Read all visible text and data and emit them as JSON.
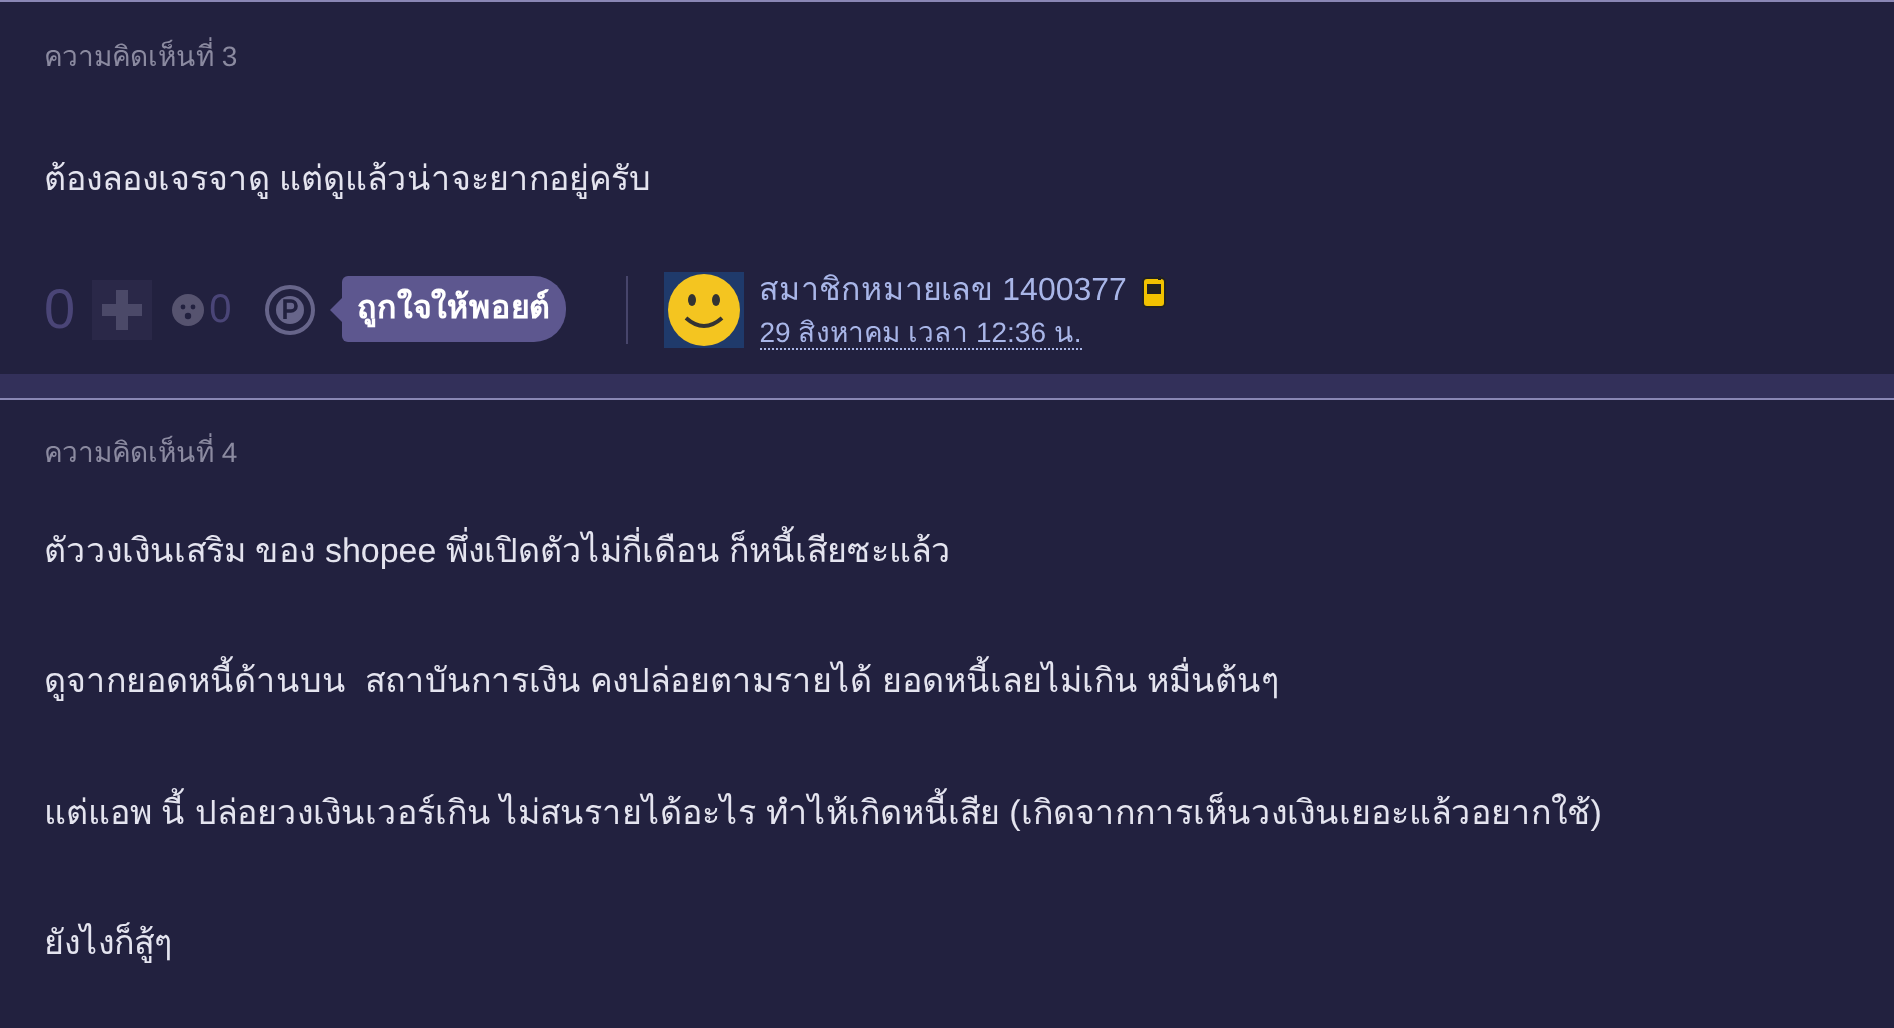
{
  "comments": [
    {
      "label": "ความคิดเห็นที่ 3",
      "paragraphs": [
        "ต้องลองเจรจาดู แต่ดูแล้วน่าจะยากอยู่ครับ"
      ],
      "footer": {
        "score": "0",
        "emotion_count": "0",
        "point_button": "ถูกใจให้พอยต์",
        "member": "สมาชิกหมายเลข 1400377",
        "date": "29 สิงหาคม เวลา 12:36 น."
      }
    },
    {
      "label": "ความคิดเห็นที่ 4",
      "paragraphs": [
        "ตัววงเงินเสริม ของ shopee พึ่งเปิดตัวไม่กี่เดือน ก็หนี้เสียซะแล้ว",
        "ดูจากยอดหนี้ด้านบน  สถาบันการเงิน คงปล่อยตามรายได้ ยอดหนี้เลยไม่เกิน หมื่นต้นๆ",
        "แต่แอพ นี้ ปล่อยวงเงินเวอร์เกิน ไม่สนรายได้อะไร ทำไห้เกิดหนี้เสีย (เกิดจากการเห็นวงเงินเยอะแล้วอยากใช้)",
        "ยังไงก็สู้ๆ"
      ]
    }
  ]
}
